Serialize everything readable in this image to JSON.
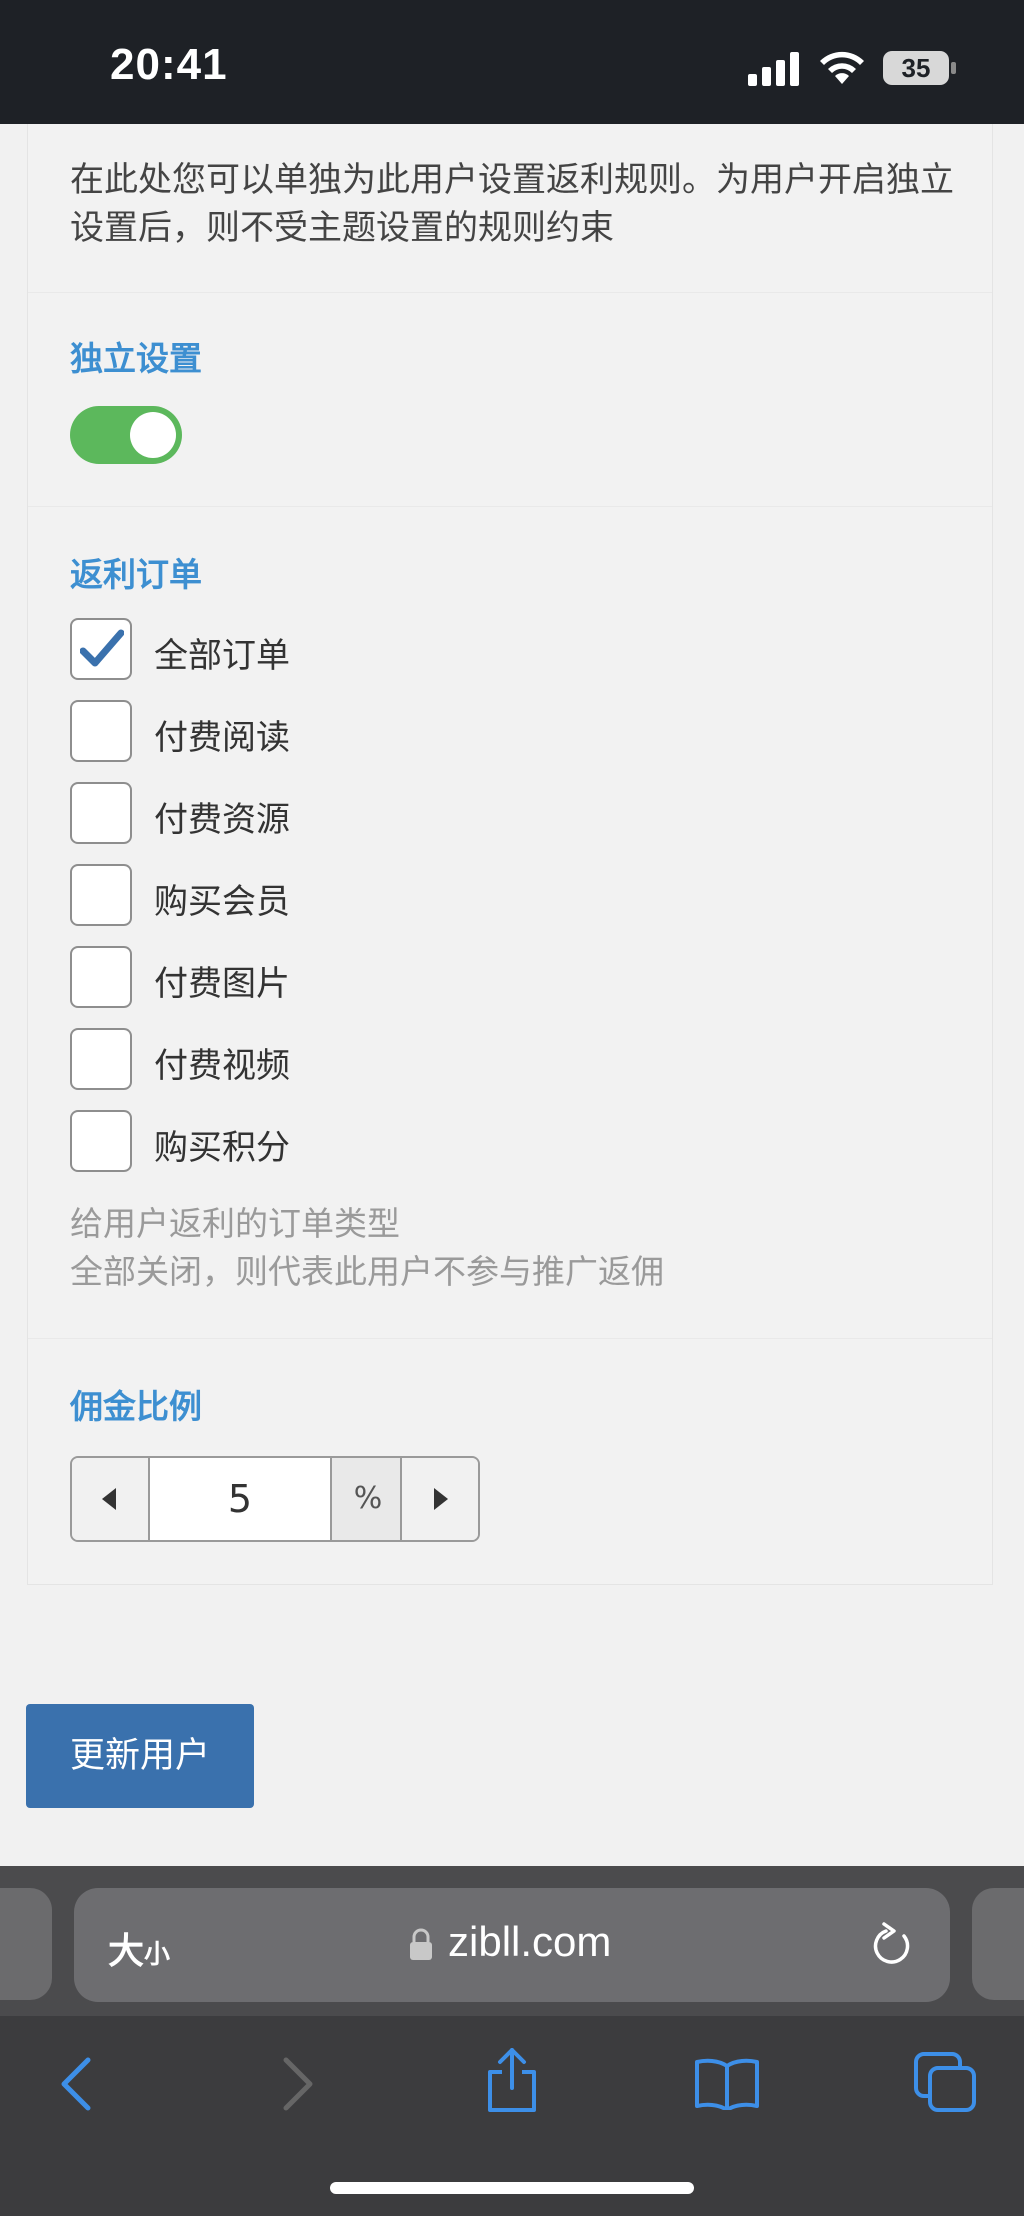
{
  "status": {
    "time": "20:41",
    "battery": "35"
  },
  "panel": {
    "description": "在此处您可以单独为此用户设置返利规则。为用户开启独立设置后，则不受主题设置的规则约束",
    "independent": {
      "label": "独立设置",
      "enabled": true
    },
    "rebate_orders": {
      "label": "返利订单",
      "options": [
        {
          "label": "全部订单",
          "checked": true
        },
        {
          "label": "付费阅读",
          "checked": false
        },
        {
          "label": "付费资源",
          "checked": false
        },
        {
          "label": "购买会员",
          "checked": false
        },
        {
          "label": "付费图片",
          "checked": false
        },
        {
          "label": "付费视频",
          "checked": false
        },
        {
          "label": "购买积分",
          "checked": false
        }
      ],
      "help_line1": "给用户返利的订单类型",
      "help_line2": "全部关闭，则代表此用户不参与推广返佣"
    },
    "commission": {
      "label": "佣金比例",
      "value": "5",
      "unit": "%"
    }
  },
  "update_button": "更新用户",
  "safari": {
    "text_size": "大",
    "text_size_small": "小",
    "domain": "zibll.com"
  },
  "colors": {
    "accent": "#3d8fd1",
    "toggle_on": "#5cb85c",
    "button": "#3a71ad"
  }
}
